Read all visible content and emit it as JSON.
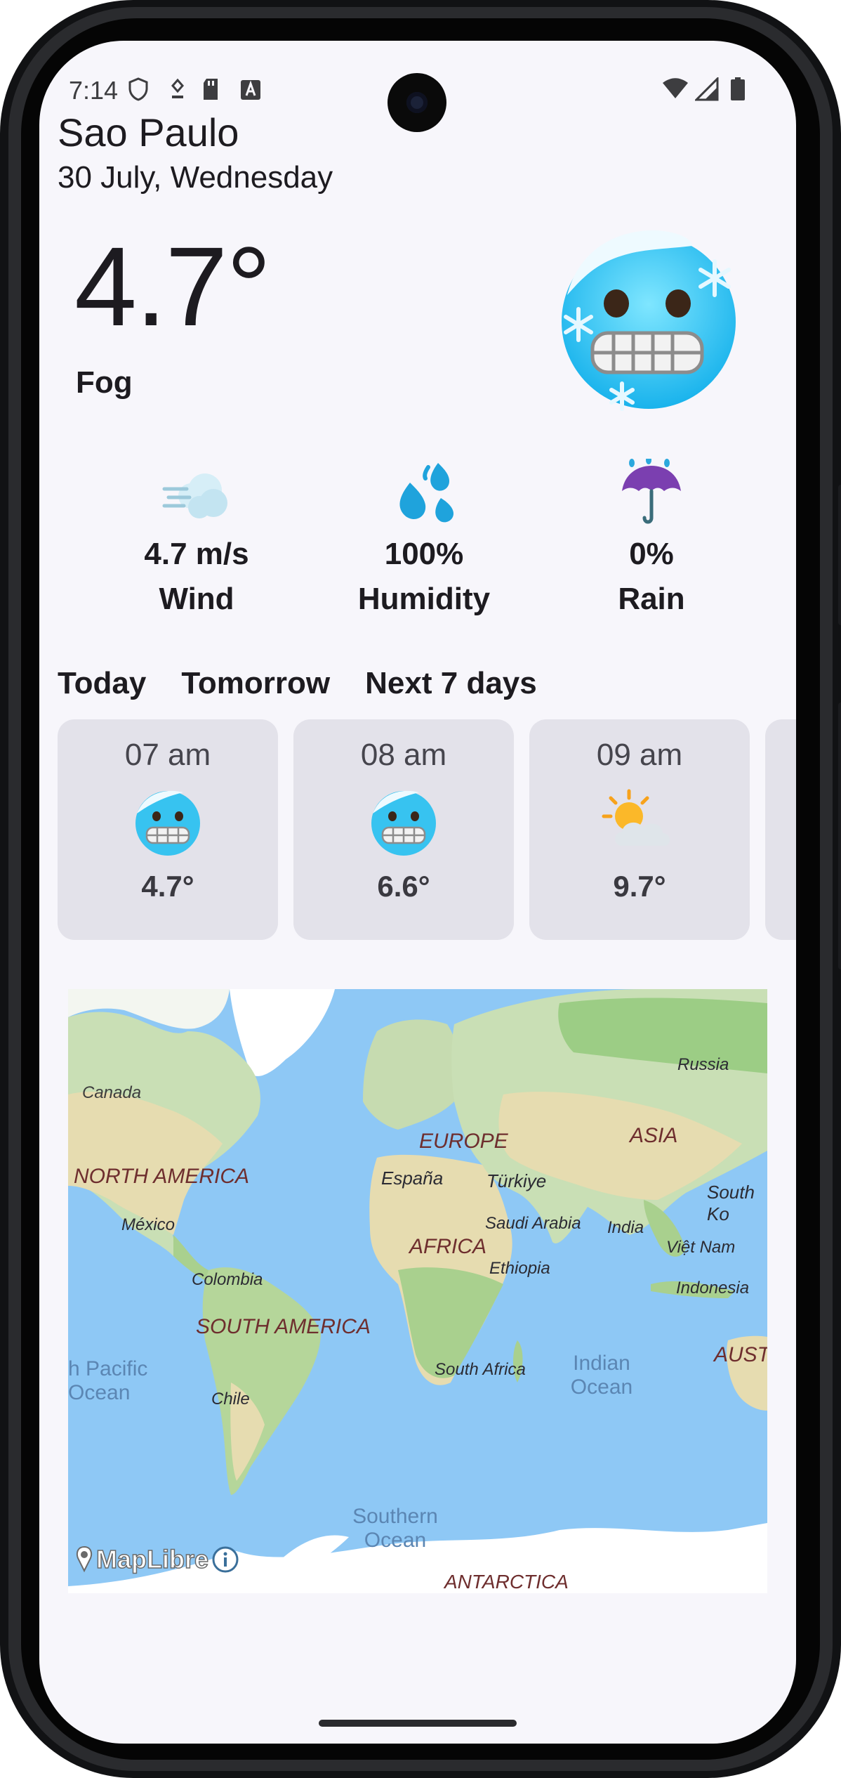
{
  "status_bar": {
    "time": "7:14"
  },
  "header": {
    "city": "Sao Paulo",
    "date": "30 July, Wednesday"
  },
  "current": {
    "temperature": "4.7°",
    "condition": "Fog",
    "icon": "cold-face-emoji"
  },
  "metrics": [
    {
      "value": "4.7 m/s",
      "label": "Wind",
      "icon": "wind-icon"
    },
    {
      "value": "100%",
      "label": "Humidity",
      "icon": "droplets-icon"
    },
    {
      "value": "0%",
      "label": "Rain",
      "icon": "umbrella-rain-icon"
    }
  ],
  "tabs": [
    "Today",
    "Tomorrow",
    "Next 7 days"
  ],
  "hourly": [
    {
      "hour": "07 am",
      "temp": "4.7°",
      "icon": "cold-face-emoji"
    },
    {
      "hour": "08 am",
      "temp": "6.6°",
      "icon": "cold-face-emoji"
    },
    {
      "hour": "09 am",
      "temp": "9.7°",
      "icon": "sun-behind-cloud-icon"
    }
  ],
  "map": {
    "attribution": "MapLibre",
    "labels": {
      "canada": "Canada",
      "russia": "Russia",
      "europe": "EUROPE",
      "asia": "ASIA",
      "north_america": "NORTH AMERICA",
      "espana": "España",
      "turkiye": "Türkiye",
      "south_k": "South Ko",
      "mexico": "México",
      "saudi": "Saudi Arabia",
      "india": "India",
      "africa": "AFRICA",
      "vietnam": "Việt Nam",
      "ethiopia": "Ethiopia",
      "colombia": "Colombia",
      "indonesia": "Indonesia",
      "south_america": "SOUTH AMERICA",
      "austr": "AUSTR",
      "pacific": "h Pacific\nOcean",
      "south_africa": "South Africa",
      "indian_ocean": "Indian\nOcean",
      "chile": "Chile",
      "southern_ocean": "Southern\nOcean",
      "antarctica": "ANTARCTICA"
    }
  }
}
